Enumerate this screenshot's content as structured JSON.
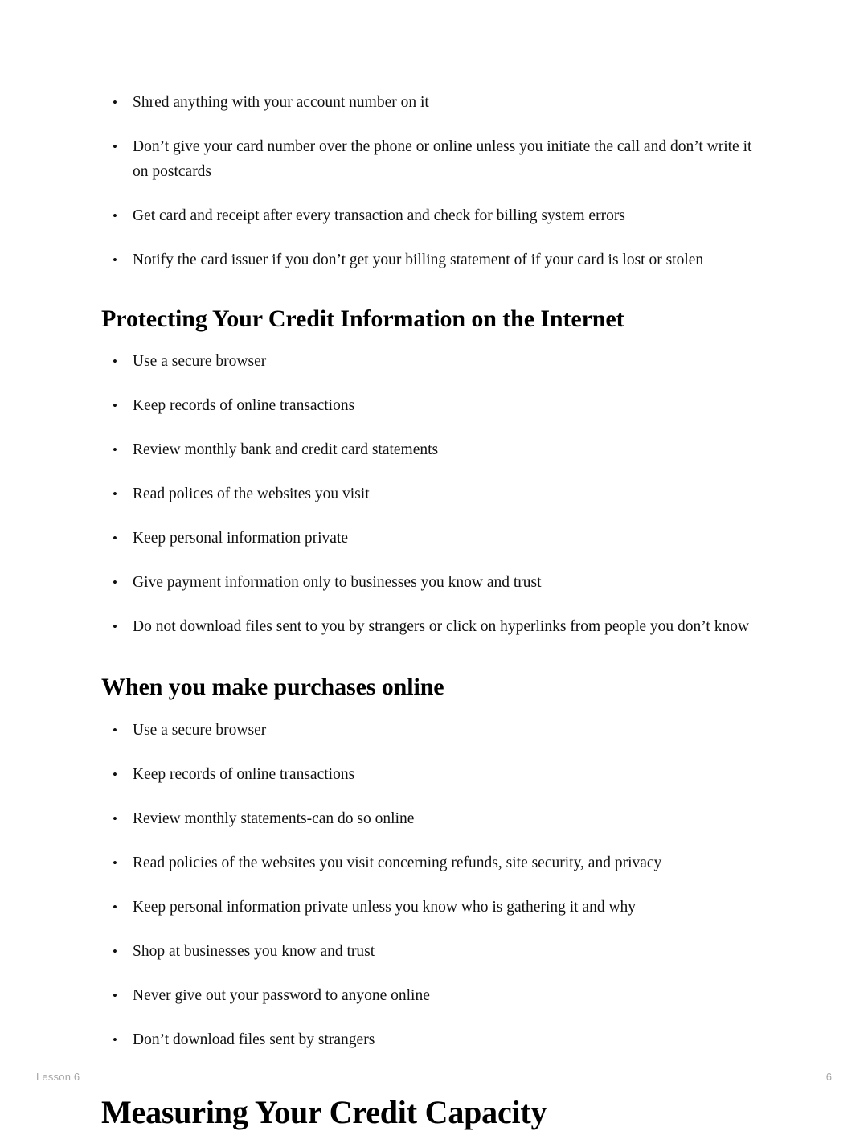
{
  "document": {
    "background_color": "#ffffff",
    "text_color": "#111111"
  },
  "sections": {
    "intro_list": {
      "items": [
        "Shred anything with your account number on it",
        "Don’t give your card number over the phone or online unless you initiate the call and don’t write it on postcards",
        "Get card and receipt after every transaction and check for billing system errors",
        "Notify the card issuer if you don’t get your billing statement of if your card is lost or stolen"
      ]
    },
    "protecting_credit": {
      "heading": "Protecting Your Credit Information on the Internet",
      "items": [
        "Use a secure browser",
        "Keep records of online transactions",
        "Review monthly bank and credit card statements",
        "Read polices of the websites you visit",
        "Keep personal information private",
        "Give payment information only to businesses you know and trust",
        "Do not download files sent to you by strangers or click on hyperlinks from people you don’t know"
      ]
    },
    "purchases_online": {
      "heading": "When you make purchases online",
      "items": [
        "Use a secure browser",
        "Keep records of online transactions",
        "Review monthly statements-can do so online",
        "Read policies of the websites you visit concerning refunds, site security, and privacy",
        "Keep personal information private unless you know who is gathering it and why",
        "Shop at businesses you know and trust",
        "Never give out your password to anyone online",
        "Don’t download files sent by strangers"
      ]
    },
    "measuring_capacity": {
      "heading": "Measuring Your Credit Capacity"
    }
  },
  "footer": {
    "lesson_label": "Lesson 6",
    "page_number": "6",
    "color": "#a6a6a6"
  }
}
